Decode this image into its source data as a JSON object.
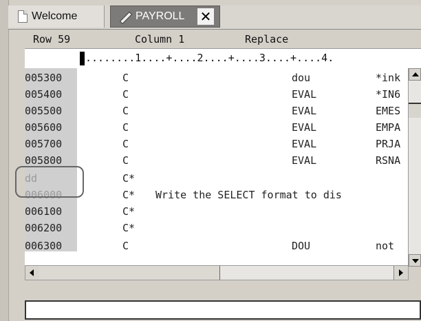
{
  "tabs": [
    {
      "label": "Welcome",
      "icon": "document-icon"
    },
    {
      "label": "PAYROLL",
      "icon": "pencil-icon",
      "active": true,
      "close": "✕"
    }
  ],
  "status": {
    "row": "Row 59",
    "column": "Column 1",
    "mode": "Replace"
  },
  "ruler": "........1....+....2....+....3....+....4.",
  "lines": [
    {
      "seq": "005300",
      "spec": "C",
      "op1": "dou",
      "op2": "*ink"
    },
    {
      "seq": "005400",
      "spec": "C",
      "op1": "EVAL",
      "op2": "*IN6"
    },
    {
      "seq": "005500",
      "spec": "C",
      "op1": "EVAL",
      "op2": "EMES"
    },
    {
      "seq": "005600",
      "spec": "C",
      "op1": "EVAL",
      "op2": "EMPA"
    },
    {
      "seq": "005700",
      "spec": "C",
      "op1": "EVAL",
      "op2": "PRJA"
    },
    {
      "seq": "005800",
      "spec": "C",
      "op1": "EVAL",
      "op2": "RSNA"
    },
    {
      "seq": "dd",
      "spec": "C*",
      "comment": ""
    },
    {
      "seq": "006000",
      "spec": "C*",
      "comment": "Write the SELECT format to dis"
    },
    {
      "seq": "006100",
      "spec": "C*",
      "comment": ""
    },
    {
      "seq": "006200",
      "spec": "C*",
      "comment": ""
    },
    {
      "seq": "006300",
      "spec": "C",
      "op1": "DOU",
      "op2": "not"
    }
  ],
  "colors": {
    "tab_active_bg": "#7c7b79",
    "prefix_area_bg": "#cfcfcf",
    "window_bg": "#d4d0c8"
  }
}
